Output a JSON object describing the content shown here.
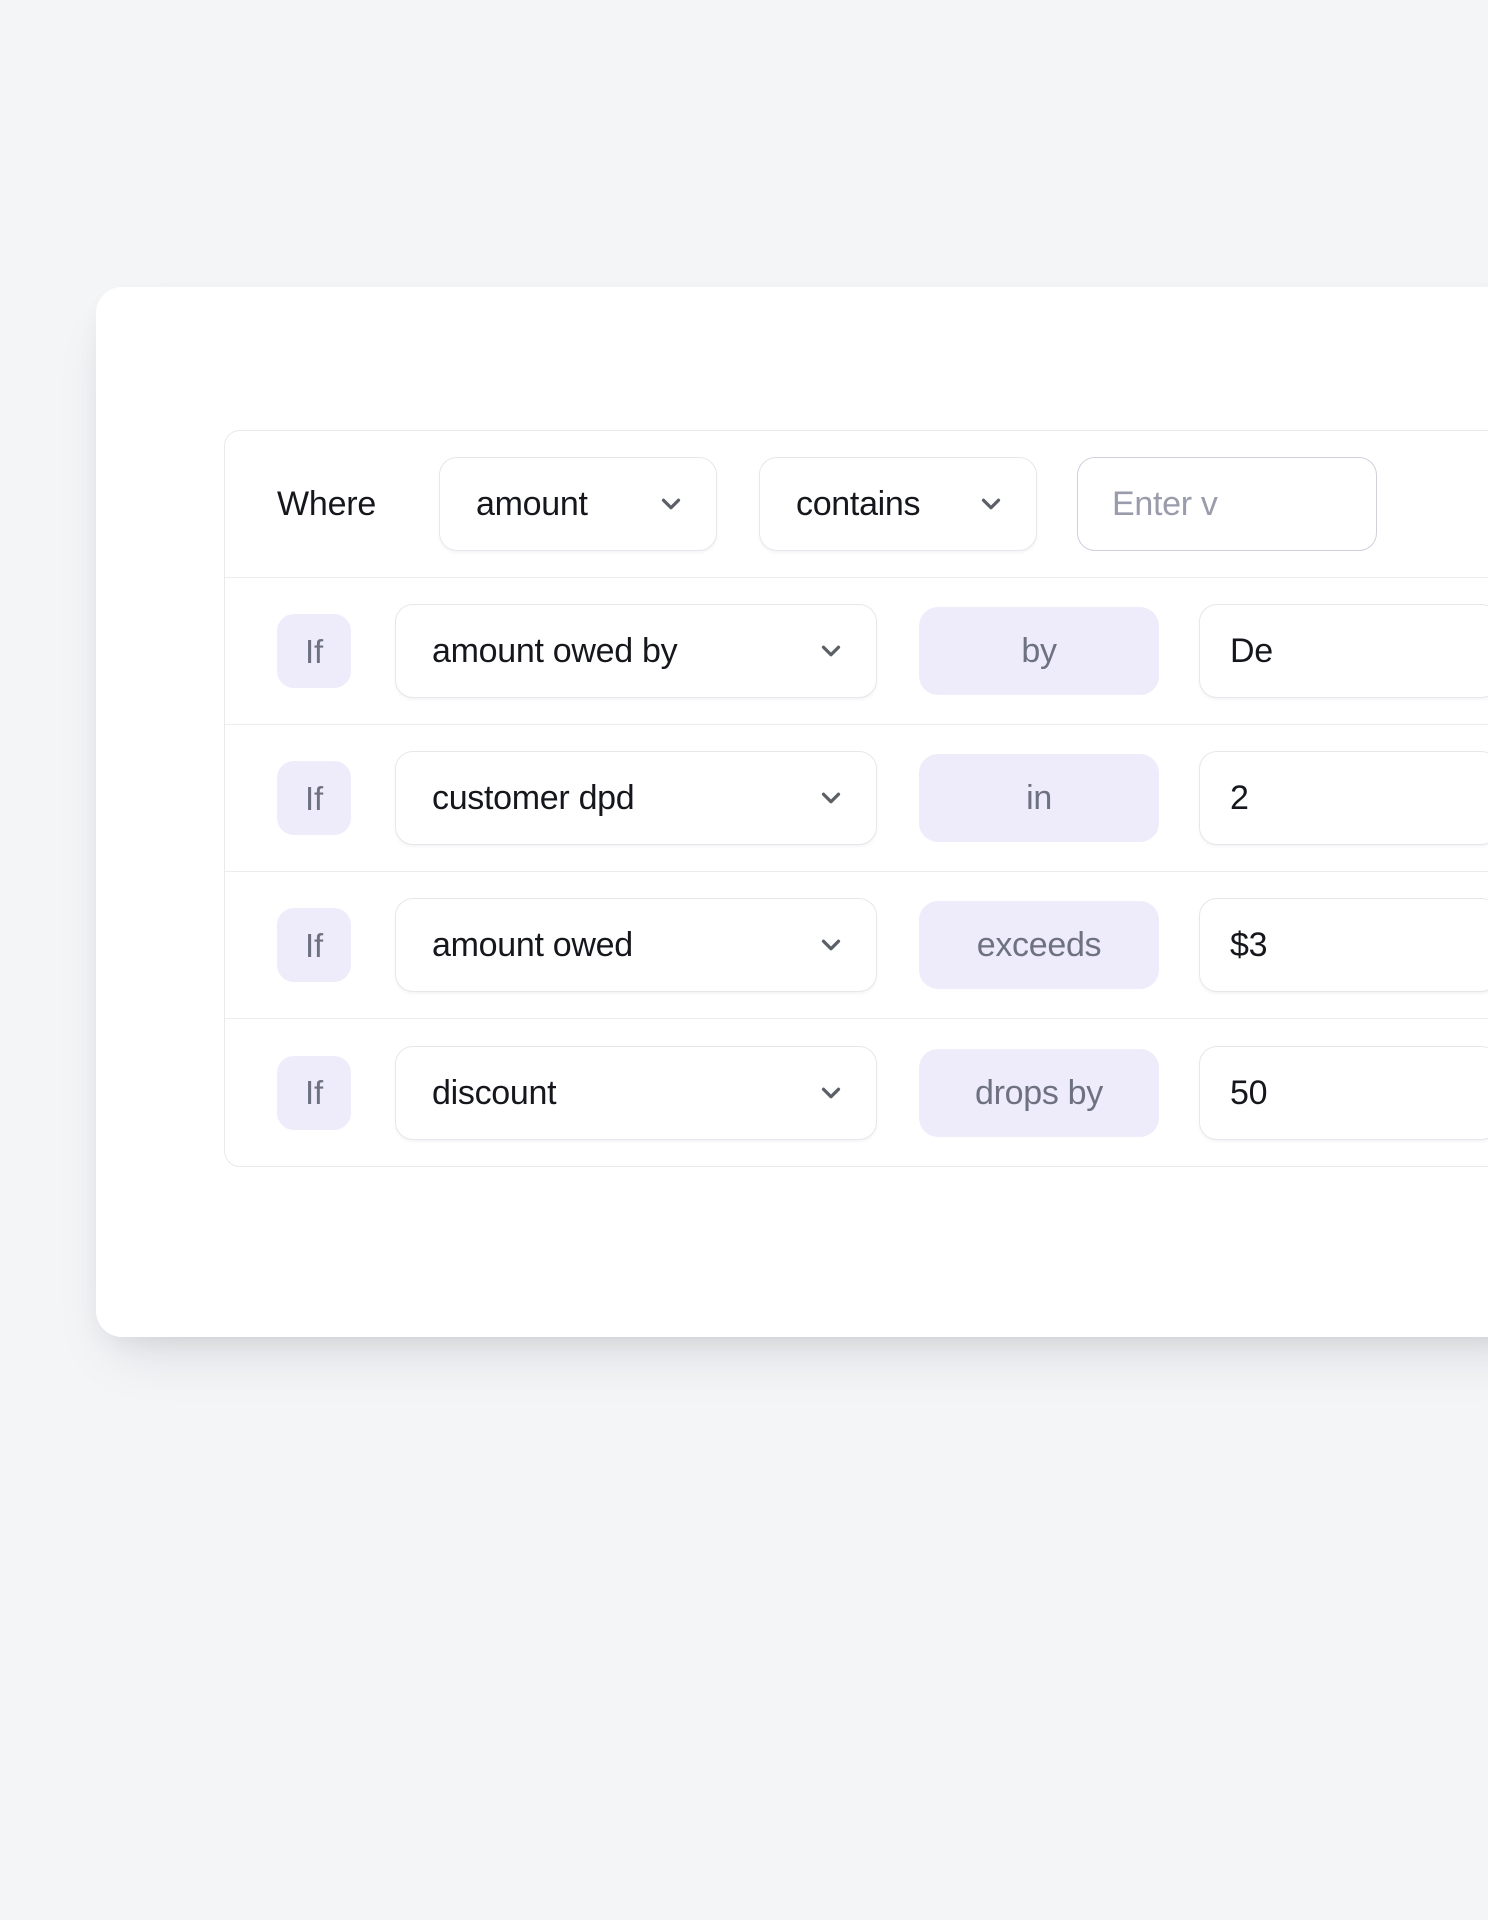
{
  "theme": {
    "page_background": "#f4f5f7",
    "card_background": "#ffffff",
    "chip_background": "#eeecfb",
    "chip_text": "#6e7280",
    "text_primary": "#15171c",
    "placeholder_text": "#9a9cab",
    "border": "#e6e7eb",
    "input_border": "#cfd0dc"
  },
  "filter_builder": {
    "rows": [
      {
        "prefix": "Where",
        "prefix_type": "label",
        "field": "amount",
        "field_icon": "chevron-down-icon",
        "operator": "contains",
        "operator_type": "dropdown",
        "operator_icon": "chevron-down-icon",
        "value": "",
        "value_type": "input",
        "value_placeholder": "Enter v"
      },
      {
        "prefix": "If",
        "prefix_type": "badge",
        "field": "amount owed by",
        "field_icon": "chevron-down-icon",
        "operator": "by",
        "operator_type": "chip",
        "value": "De",
        "value_type": "box",
        "value_placeholder": ""
      },
      {
        "prefix": "If",
        "prefix_type": "badge",
        "field": "customer dpd",
        "field_icon": "chevron-down-icon",
        "operator": "in",
        "operator_type": "chip",
        "value": "2",
        "value_type": "box",
        "value_placeholder": ""
      },
      {
        "prefix": "If",
        "prefix_type": "badge",
        "field": "amount owed",
        "field_icon": "chevron-down-icon",
        "operator": "exceeds",
        "operator_type": "chip",
        "value": "$3",
        "value_type": "box",
        "value_placeholder": ""
      },
      {
        "prefix": "If",
        "prefix_type": "badge",
        "field": "discount",
        "field_icon": "chevron-down-icon",
        "operator": "drops by",
        "operator_type": "chip",
        "value": "50",
        "value_type": "box",
        "value_placeholder": ""
      }
    ]
  }
}
